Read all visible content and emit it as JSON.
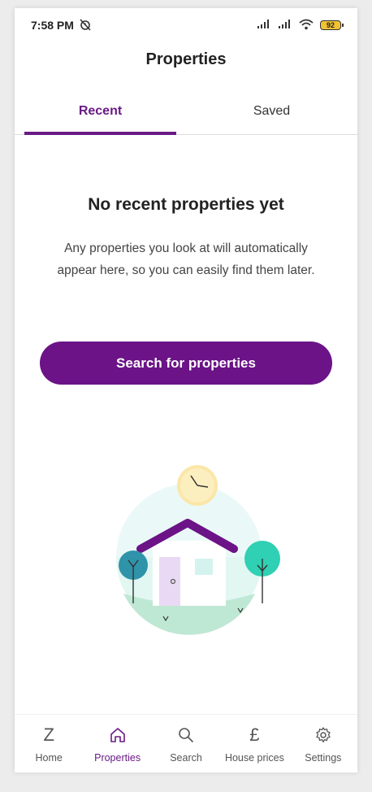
{
  "status_bar": {
    "time": "7:58 PM",
    "battery": "92"
  },
  "header": {
    "title": "Properties"
  },
  "tabs": [
    {
      "label": "Recent",
      "active": true
    },
    {
      "label": "Saved",
      "active": false
    }
  ],
  "empty_state": {
    "title": "No recent properties yet",
    "text": "Any properties you look at will automatically appear here, so you can easily find them later.",
    "button_label": "Search for properties"
  },
  "bottom_nav": [
    {
      "label": "Home",
      "icon": "z-logo-icon",
      "glyph": "Z"
    },
    {
      "label": "Properties",
      "icon": "house-icon",
      "active": true
    },
    {
      "label": "Search",
      "icon": "search-icon"
    },
    {
      "label": "House prices",
      "icon": "pound-icon",
      "glyph": "£"
    },
    {
      "label": "Settings",
      "icon": "gear-icon"
    }
  ],
  "colors": {
    "accent": "#6b1387",
    "tab_active": "#6a1b86"
  }
}
